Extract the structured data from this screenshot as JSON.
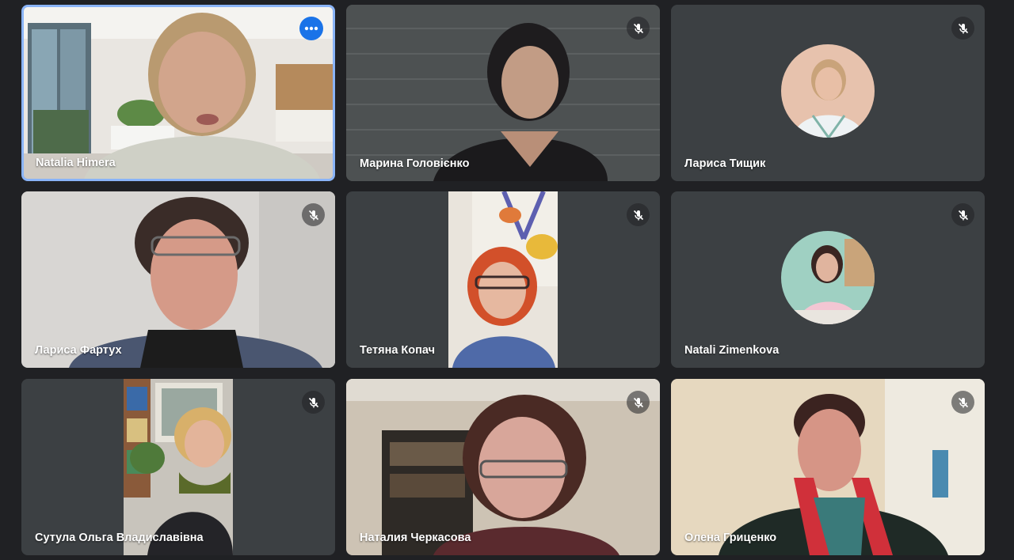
{
  "participants": [
    {
      "name": "Natalia Himera",
      "active": true,
      "control": "more-options-icon"
    },
    {
      "name": "Марина Головієнко",
      "muted": true
    },
    {
      "name": "Лариса Тищик",
      "muted": true,
      "avatar": true
    },
    {
      "name": "Лариса Фартух",
      "muted": true
    },
    {
      "name": "Тетяна Копач",
      "muted": true
    },
    {
      "name": "Natali Zimenkova",
      "muted": true,
      "avatar": true
    },
    {
      "name": "Сутула Ольга Владиславівна",
      "muted": true
    },
    {
      "name": "Наталия Черкасова",
      "muted": true
    },
    {
      "name": "Олена Гриценко",
      "muted": true
    }
  ],
  "colors": {
    "background": "#202124",
    "tile": "#3c4043",
    "active_border": "#8ab4f8",
    "more_button": "#1a73e8"
  },
  "icons": {
    "muted": "mic-off-icon",
    "more": "more-options-icon"
  }
}
